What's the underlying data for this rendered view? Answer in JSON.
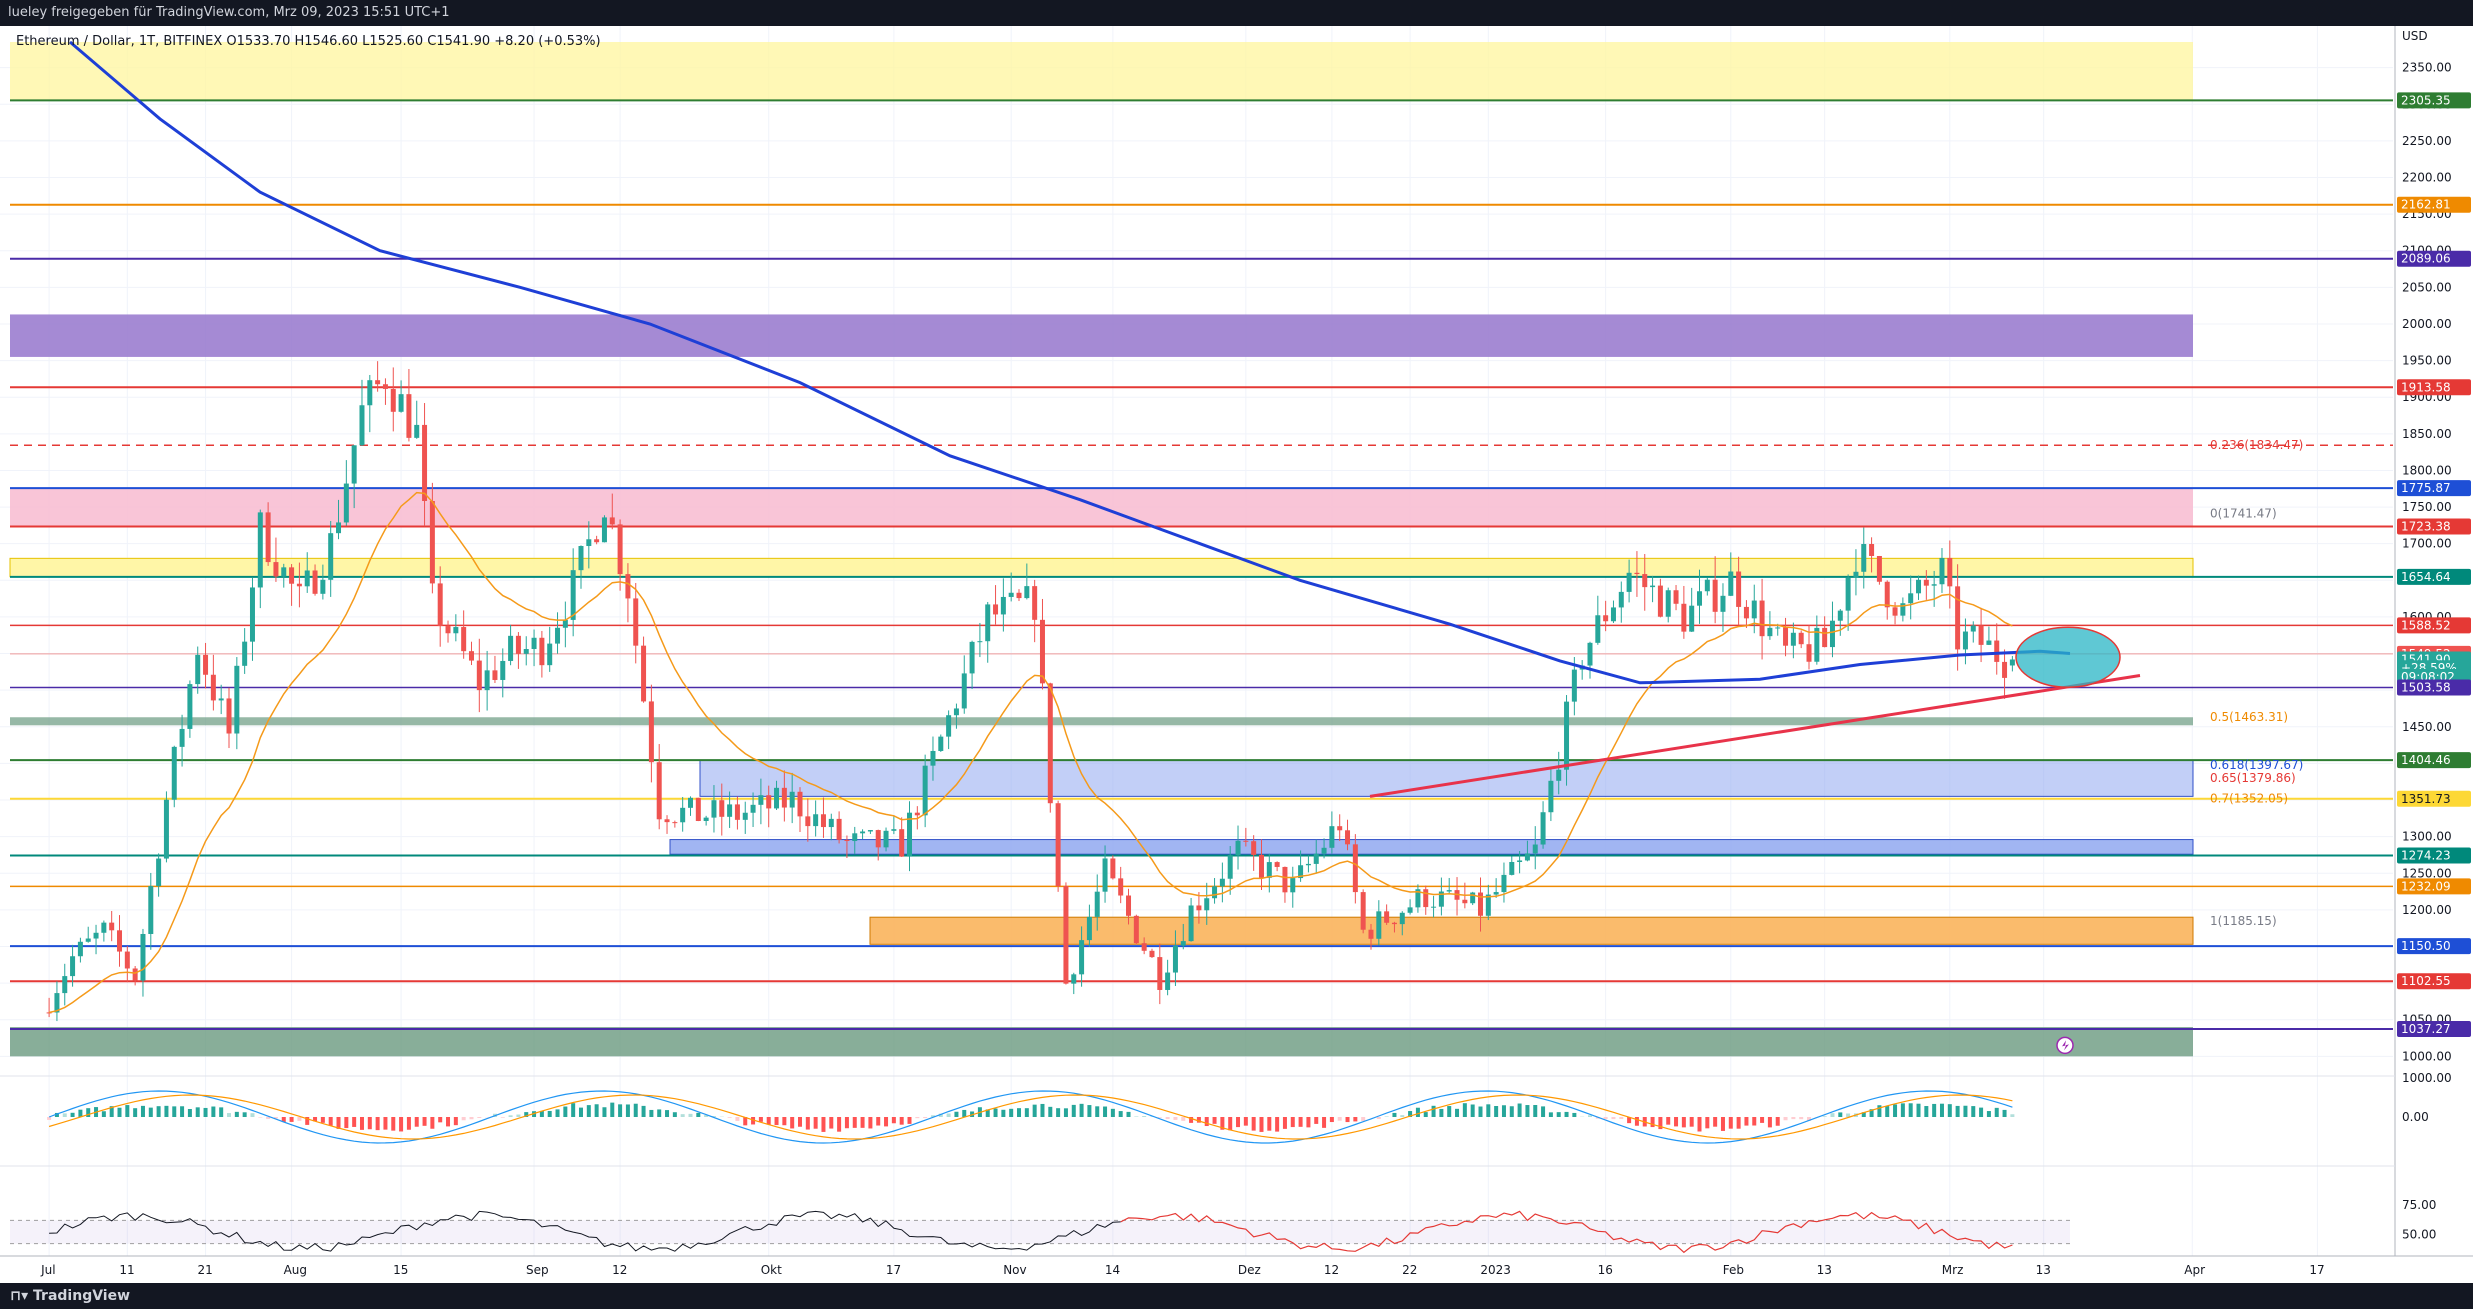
{
  "header": {
    "attribution": "lueley freigegeben für TradingView.com, Mrz 09, 2023 15:51 UTC+1",
    "symbol_line": "Ethereum / Dollar, 1T, BITFINEX  O1533.70  H1546.60  L1525.60  C1541.90  +8.20 (+0.53%)"
  },
  "footer": {
    "brand": "TradingView"
  },
  "axis": {
    "currency": "USD",
    "price_ticks": [
      "2350.00",
      "2300.00",
      "2250.00",
      "2200.00",
      "2150.00",
      "2100.00",
      "2050.00",
      "2000.00",
      "1950.00",
      "1900.00",
      "1850.00",
      "1800.00",
      "1750.00",
      "1700.00",
      "1650.00",
      "1600.00",
      "1550.00",
      "1500.00",
      "1450.00",
      "1400.00",
      "1350.00",
      "1300.00",
      "1250.00",
      "1200.00",
      "1150.00",
      "1100.00",
      "1050.00",
      "1000.00"
    ],
    "time_ticks": [
      "Jul",
      "11",
      "21",
      "Aug",
      "15",
      "Sep",
      "12",
      "Okt",
      "17",
      "Nov",
      "14",
      "Dez",
      "12",
      "22",
      "2023",
      "16",
      "Feb",
      "13",
      "Mrz",
      "13",
      "Apr",
      "17"
    ],
    "macd_ticks": [
      "1000.00",
      "0.00"
    ],
    "rsi_ticks": [
      "75.00",
      "50.00"
    ]
  },
  "colors": {
    "up": "#26a69a",
    "down": "#ef5350",
    "ma200": "#1e3fd6",
    "ema": "#f59a1a",
    "trendline": "#e8334a",
    "zone_yellow": "#fff59d",
    "zone_purple": "#9575cd",
    "zone_pink": "#f8bbd0",
    "zone_blue": "#90a8f0",
    "zone_orange": "#f9b45c",
    "zone_green": "#6a9a80"
  },
  "price_labels": [
    {
      "text": "2305.35",
      "price": 2305.35,
      "bg": "#2e7d32",
      "fg": "#ffffff"
    },
    {
      "text": "2162.81",
      "price": 2162.81,
      "bg": "#ef8a00",
      "fg": "#ffffff"
    },
    {
      "text": "2089.06",
      "price": 2089.06,
      "bg": "#4a2ba8",
      "fg": "#ffffff"
    },
    {
      "text": "1913.58",
      "price": 1913.58,
      "bg": "#e53935",
      "fg": "#ffffff"
    },
    {
      "text": "1775.87",
      "price": 1775.87,
      "bg": "#1e4fd6",
      "fg": "#ffffff"
    },
    {
      "text": "1723.38",
      "price": 1723.38,
      "bg": "#e53935",
      "fg": "#ffffff"
    },
    {
      "text": "1654.64",
      "price": 1654.64,
      "bg": "#00897b",
      "fg": "#ffffff"
    },
    {
      "text": "1588.52",
      "price": 1588.52,
      "bg": "#e53935",
      "fg": "#ffffff"
    },
    {
      "text": "1549.52",
      "price": 1549.52,
      "bg": "#ef5350",
      "fg": "#ffffff"
    },
    {
      "text": "1541.90",
      "price": 1541.9,
      "bg": "#26a69a",
      "fg": "#ffffff"
    },
    {
      "text": "+28.59%",
      "price": 1530,
      "bg": "#26a69a",
      "fg": "#ffffff"
    },
    {
      "text": "09:08:02",
      "price": 1518,
      "bg": "#26a69a",
      "fg": "#ffffff"
    },
    {
      "text": "1503.58",
      "price": 1503.58,
      "bg": "#4a2ba8",
      "fg": "#ffffff"
    },
    {
      "text": "1404.46",
      "price": 1404.46,
      "bg": "#2e7d32",
      "fg": "#ffffff"
    },
    {
      "text": "1351.73",
      "price": 1351.73,
      "bg": "#fdd835",
      "fg": "#131722"
    },
    {
      "text": "1274.23",
      "price": 1274.23,
      "bg": "#00897b",
      "fg": "#ffffff"
    },
    {
      "text": "1232.09",
      "price": 1232.09,
      "bg": "#ef8a00",
      "fg": "#ffffff"
    },
    {
      "text": "1150.50",
      "price": 1150.5,
      "bg": "#1e4fd6",
      "fg": "#ffffff"
    },
    {
      "text": "1102.55",
      "price": 1102.55,
      "bg": "#e53935",
      "fg": "#ffffff"
    },
    {
      "text": "1037.27",
      "price": 1037.27,
      "bg": "#4a2ba8",
      "fg": "#ffffff"
    }
  ],
  "fib_labels": [
    {
      "text": "0.236(1834.47)",
      "price": 1834.47,
      "color": "#e53935"
    },
    {
      "text": "0(1741.47)",
      "price": 1741.47,
      "color": "#787b86"
    },
    {
      "text": "0.5(1463.31)",
      "price": 1463.31,
      "color": "#ef8a00"
    },
    {
      "text": "0.618(1397.67)",
      "price": 1397.67,
      "color": "#1e4fd6"
    },
    {
      "text": "0.65(1379.86)",
      "price": 1379.86,
      "color": "#e53935"
    },
    {
      "text": "0.7(1352.05)",
      "price": 1352.05,
      "color": "#ef8a00"
    },
    {
      "text": "1(1185.15)",
      "price": 1185.15,
      "color": "#787b86"
    }
  ],
  "chart_data": {
    "type": "candlestick",
    "title": "Ethereum / Dollar, 1T, BITFINEX",
    "ylim": [
      980,
      2385
    ],
    "approx_close_series": [
      {
        "date": "2022-07-01",
        "close": 1060
      },
      {
        "date": "2022-07-05",
        "close": 1135
      },
      {
        "date": "2022-07-09",
        "close": 1170
      },
      {
        "date": "2022-07-13",
        "close": 1110
      },
      {
        "date": "2022-07-17",
        "close": 1350
      },
      {
        "date": "2022-07-21",
        "close": 1560
      },
      {
        "date": "2022-07-25",
        "close": 1440
      },
      {
        "date": "2022-07-29",
        "close": 1720
      },
      {
        "date": "2022-08-03",
        "close": 1620
      },
      {
        "date": "2022-08-07",
        "close": 1700
      },
      {
        "date": "2022-08-11",
        "close": 1880
      },
      {
        "date": "2022-08-14",
        "close": 1930
      },
      {
        "date": "2022-08-18",
        "close": 1850
      },
      {
        "date": "2022-08-20",
        "close": 1620
      },
      {
        "date": "2022-08-26",
        "close": 1510
      },
      {
        "date": "2022-08-30",
        "close": 1550
      },
      {
        "date": "2022-09-03",
        "close": 1560
      },
      {
        "date": "2022-09-07",
        "close": 1640
      },
      {
        "date": "2022-09-11",
        "close": 1760
      },
      {
        "date": "2022-09-14",
        "close": 1640
      },
      {
        "date": "2022-09-18",
        "close": 1340
      },
      {
        "date": "2022-09-22",
        "close": 1330
      },
      {
        "date": "2022-09-28",
        "close": 1330
      },
      {
        "date": "2022-10-05",
        "close": 1350
      },
      {
        "date": "2022-10-12",
        "close": 1290
      },
      {
        "date": "2022-10-19",
        "close": 1290
      },
      {
        "date": "2022-10-25",
        "close": 1460
      },
      {
        "date": "2022-10-30",
        "close": 1600
      },
      {
        "date": "2022-11-05",
        "close": 1620
      },
      {
        "date": "2022-11-09",
        "close": 1100
      },
      {
        "date": "2022-11-14",
        "close": 1250
      },
      {
        "date": "2022-11-21",
        "close": 1110
      },
      {
        "date": "2022-11-25",
        "close": 1200
      },
      {
        "date": "2022-12-01",
        "close": 1280
      },
      {
        "date": "2022-12-08",
        "close": 1230
      },
      {
        "date": "2022-12-14",
        "close": 1320
      },
      {
        "date": "2022-12-17",
        "close": 1170
      },
      {
        "date": "2022-12-25",
        "close": 1220
      },
      {
        "date": "2023-01-01",
        "close": 1200
      },
      {
        "date": "2023-01-08",
        "close": 1280
      },
      {
        "date": "2023-01-14",
        "close": 1550
      },
      {
        "date": "2023-01-20",
        "close": 1660
      },
      {
        "date": "2023-01-27",
        "close": 1600
      },
      {
        "date": "2023-02-02",
        "close": 1650
      },
      {
        "date": "2023-02-09",
        "close": 1550
      },
      {
        "date": "2023-02-14",
        "close": 1560
      },
      {
        "date": "2023-02-18",
        "close": 1690
      },
      {
        "date": "2023-02-24",
        "close": 1610
      },
      {
        "date": "2023-03-01",
        "close": 1660
      },
      {
        "date": "2023-03-03",
        "close": 1570
      },
      {
        "date": "2023-03-06",
        "close": 1565
      },
      {
        "date": "2023-03-09",
        "close": 1541.9
      }
    ]
  }
}
